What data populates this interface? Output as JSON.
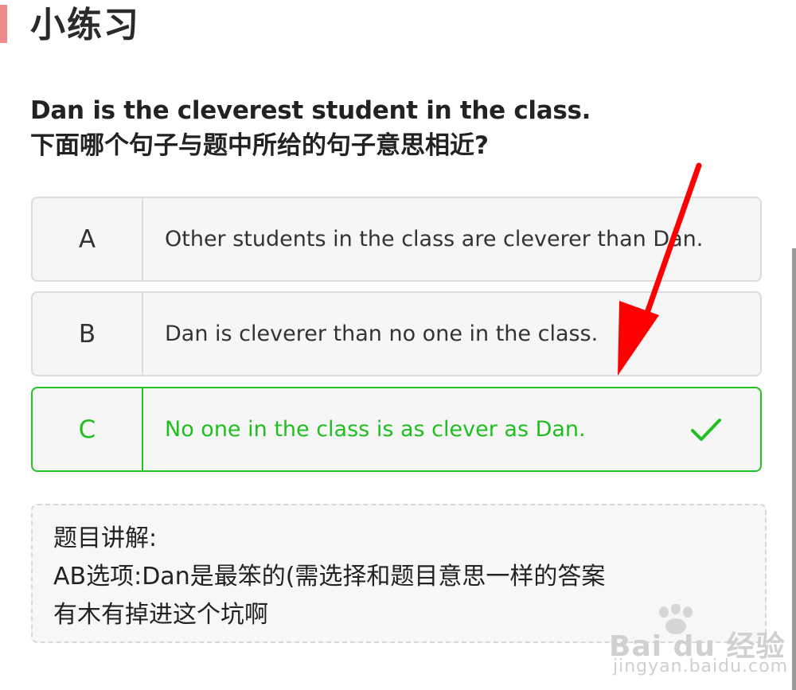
{
  "header": {
    "title": "小练习"
  },
  "question": {
    "english": "Dan is the cleverest student in the class.",
    "prompt": "下面哪个句子与题中所给的句子意思相近?"
  },
  "options": [
    {
      "letter": "A",
      "text": "Other students in the class are cleverer than Dan."
    },
    {
      "letter": "B",
      "text": "Dan is cleverer than no one in the class."
    },
    {
      "letter": "C",
      "text": "No one in the class is as clever as Dan.",
      "state": "correct"
    }
  ],
  "explanation": {
    "title": "题目讲解:",
    "line1": "AB选项:Dan是最笨的(需选择和题目意思一样的答案",
    "line2": "有木有掉进这个坑啊"
  },
  "watermark": {
    "brand": "Bai du 经验",
    "sub": "jingyan.baidu.com"
  },
  "colors": {
    "correct": "#1fbf1f",
    "accent": "#f08a8a",
    "arrow": "#ff0000"
  },
  "icons": {
    "correct_indicator": "checkmark-icon",
    "annotation": "red-arrow"
  }
}
